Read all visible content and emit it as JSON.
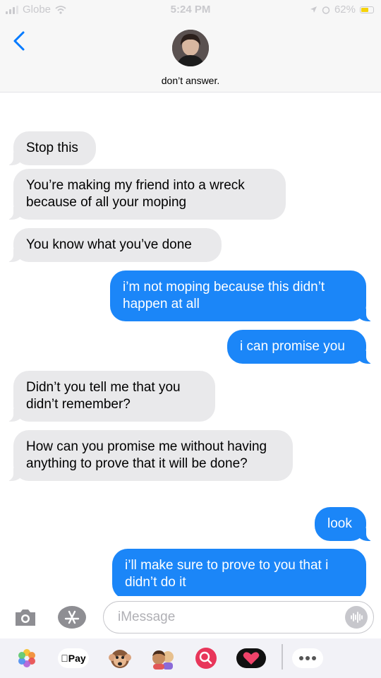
{
  "status_bar": {
    "carrier": "Globe",
    "time": "5:24 PM",
    "battery": "62%"
  },
  "header": {
    "contact_name": "don’t answer."
  },
  "messages": [
    {
      "dir": "in",
      "text": "Stop this"
    },
    {
      "dir": "in",
      "text": "You’re making my friend into a wreck because of all your moping"
    },
    {
      "dir": "in",
      "text": "You know what you’ve done"
    },
    {
      "dir": "out",
      "text": "i’m not moping because this didn’t happen at all"
    },
    {
      "dir": "out",
      "text": "i can promise you"
    },
    {
      "dir": "in",
      "text": "Didn’t you tell me that you didn’t remember?"
    },
    {
      "dir": "in",
      "text": "How can you promise me without having anything to prove that it will be done?"
    },
    {
      "dir": "out",
      "text": "look"
    },
    {
      "dir": "out",
      "text": "i’ll make sure to prove to you that i didn’t do it"
    }
  ],
  "input": {
    "placeholder": "iMessage"
  },
  "app_drawer": {
    "pay_label": "Pay",
    "items": [
      "photos-icon",
      "apple-pay",
      "animoji-icon",
      "memoji-icon",
      "web-images-icon",
      "digital-touch-icon",
      "more-icon"
    ]
  },
  "colors": {
    "incoming_bubble": "#e9e9eb",
    "outgoing_bubble": "#1b86f8",
    "accent": "#007aff"
  }
}
